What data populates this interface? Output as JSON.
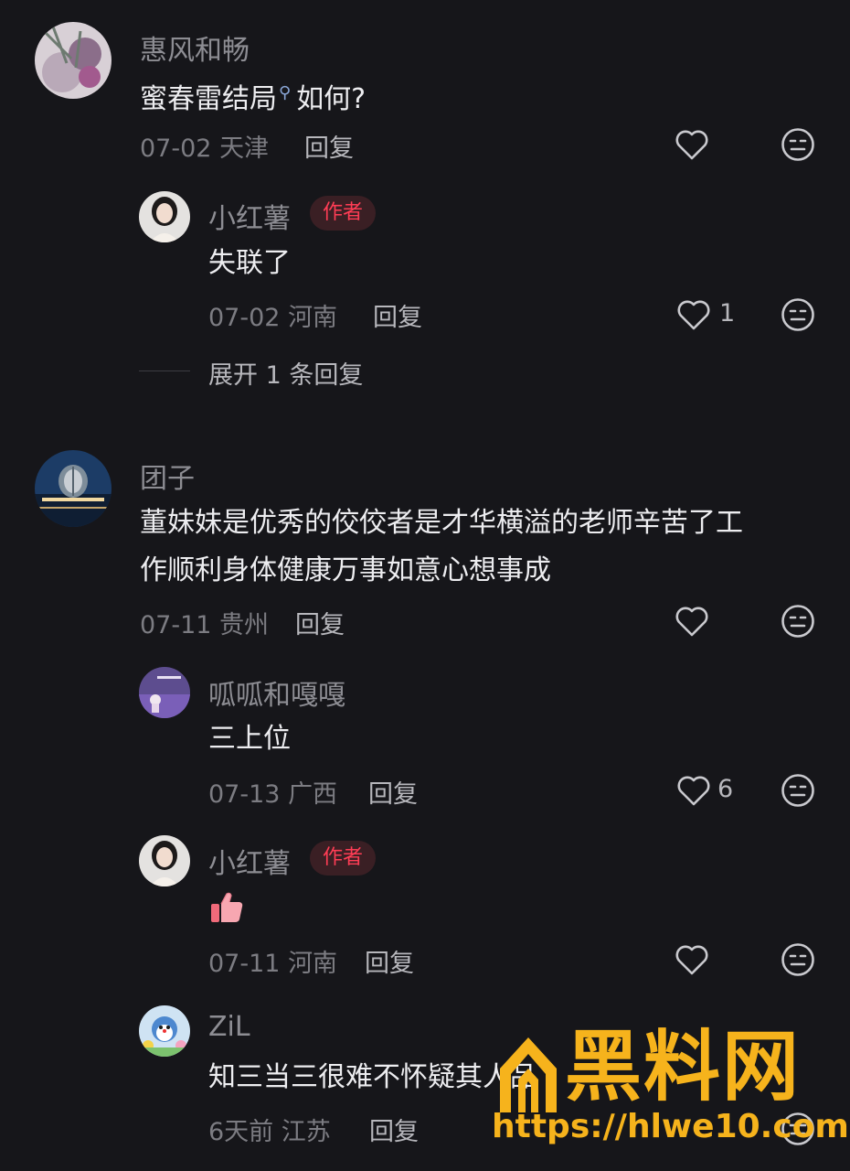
{
  "comments": [
    {
      "user": "惠风和畅",
      "text_before": "蜜春雷结局",
      "text_after": "如何?",
      "date": "07-02",
      "location": "天津",
      "reply": "回复",
      "likes": "",
      "replies": [
        {
          "user": "小红薯",
          "badge": "作者",
          "text": "失联了",
          "date": "07-02",
          "location": "河南",
          "reply": "回复",
          "likes": "1"
        }
      ],
      "expand": "展开 1 条回复"
    },
    {
      "user": "团子",
      "text_line1": "董妹妹是优秀的佼佼者是才华横溢的老师辛苦了工",
      "text_line2": "作顺利身体健康万事如意心想事成",
      "date": "07-11",
      "location": "贵州",
      "reply": "回复",
      "likes": "",
      "replies": [
        {
          "user": "呱呱和嘎嘎",
          "text": "三上位",
          "date": "07-13",
          "location": "广西",
          "reply": "回复",
          "likes": "6"
        },
        {
          "user": "小红薯",
          "badge": "作者",
          "text": "",
          "emoji": "thumbs-up-icon",
          "date": "07-11",
          "location": "河南",
          "reply": "回复",
          "likes": ""
        },
        {
          "user": "ZiL",
          "text": "知三当三很难不怀疑其人品",
          "date": "6天前",
          "location": "江苏",
          "reply": "回复",
          "likes": ""
        }
      ]
    }
  ],
  "watermark": {
    "title": "黑料网",
    "url": "https://hlwe10.com"
  },
  "colors": {
    "background": "#16161a",
    "badge_text": "#ff3d55",
    "watermark": "#f6b31c"
  }
}
